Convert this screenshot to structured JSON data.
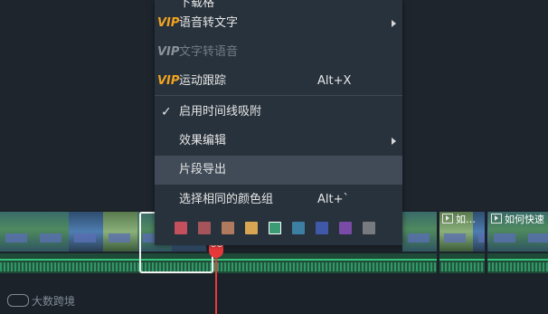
{
  "menu": {
    "items": [
      {
        "id": "truncated-top",
        "label": "下载格"
      },
      {
        "id": "speech-to-text",
        "vip": "VIP",
        "label": "语音转文字",
        "submenu": true
      },
      {
        "id": "text-to-speech",
        "vip": "VIP",
        "label": "文字转语音",
        "disabled": true
      },
      {
        "id": "motion-tracking",
        "vip": "VIP",
        "label": "运动跟踪",
        "shortcut": "Alt+X"
      },
      {
        "id": "timeline-snapping",
        "label": "启用时间线吸附",
        "checked": true
      },
      {
        "id": "effects-edit",
        "label": "效果编辑",
        "submenu": true
      },
      {
        "id": "export-segment",
        "label": "片段导出",
        "highlighted": true
      },
      {
        "id": "select-same-color",
        "label": "选择相同的颜色组",
        "shortcut": "Alt+`"
      }
    ],
    "color_swatches": [
      "#c4505e",
      "#a6545c",
      "#b07a5e",
      "#d8a553",
      "#3a9b74",
      "#3d7fa3",
      "#3f58a8",
      "#7a4aa7",
      "#777b80"
    ],
    "selected_swatch_index": 4
  },
  "timeline": {
    "clip_labels": [
      "如…",
      "如何快速"
    ]
  },
  "watermark": {
    "text": "大数跨境"
  },
  "colors": {
    "accent_vip": "#f2a31f",
    "playhead": "#e8393a",
    "audio_line": "#35c07a",
    "menu_bg": "#28323c",
    "menu_hover": "#404b57"
  }
}
